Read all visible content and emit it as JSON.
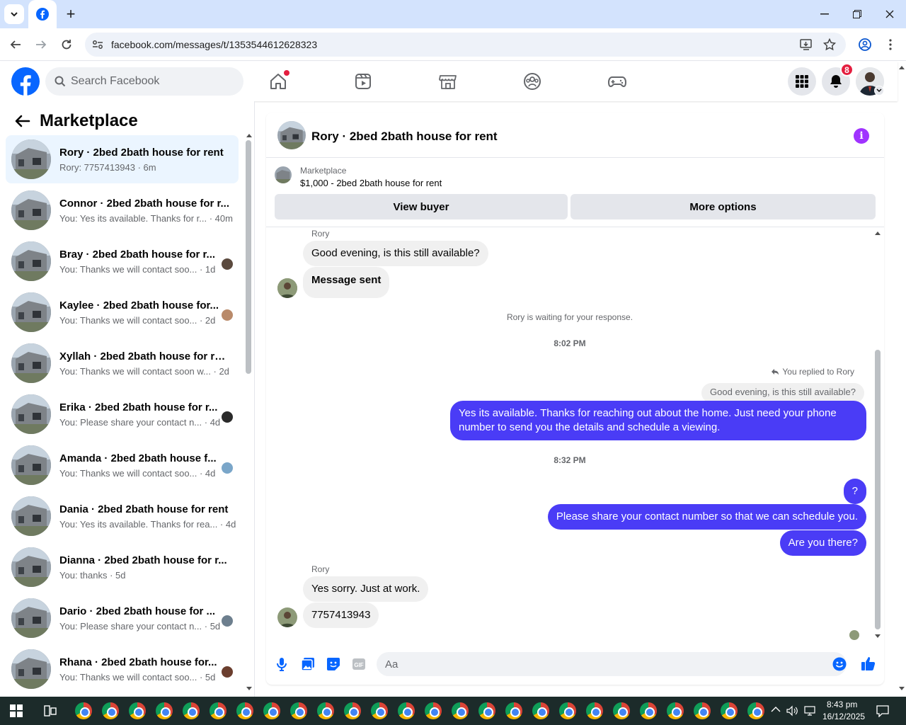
{
  "browser": {
    "url": "facebook.com/messages/t/1353544612628323"
  },
  "header": {
    "search_placeholder": "Search Facebook",
    "notification_count": "8"
  },
  "sidebar": {
    "title": "Marketplace",
    "conversations": [
      {
        "name": "Rory · 2bed 2bath house for rent",
        "preview": "Rory: 7757413943 · 6m",
        "selected": true
      },
      {
        "name": "Connor · 2bed 2bath house for r...",
        "preview": "You: Yes its available. Thanks for r... · 40m"
      },
      {
        "name": "Bray · 2bed 2bath house for r...",
        "preview": "You: Thanks we will contact soo... · 1d"
      },
      {
        "name": "Kaylee · 2bed 2bath house for...",
        "preview": "You: Thanks we will contact soo... · 2d"
      },
      {
        "name": "Xyllah · 2bed 2bath house for rent",
        "preview": "You: Thanks we will contact soon w... · 2d"
      },
      {
        "name": "Erika · 2bed 2bath house for r...",
        "preview": "You: Please share your contact n... · 4d"
      },
      {
        "name": "Amanda · 2bed 2bath house f...",
        "preview": "You: Thanks we will contact soo... · 4d"
      },
      {
        "name": "Dania · 2bed 2bath house for rent",
        "preview": "You: Yes its available. Thanks for rea... · 4d"
      },
      {
        "name": "Dianna · 2bed 2bath house for r...",
        "preview": "You: thanks · 5d"
      },
      {
        "name": "Dario · 2bed 2bath house for ...",
        "preview": "You: Please share your contact n... · 5d"
      },
      {
        "name": "Rhana · 2bed 2bath house for...",
        "preview": "You: Thanks we will contact soo... · 5d"
      }
    ]
  },
  "chat": {
    "title": "Rory · 2bed 2bath house for rent",
    "marketplace_label": "Marketplace",
    "listing": "$1,000 - 2bed 2bath house for rent",
    "view_buyer": "View buyer",
    "more_options": "More options",
    "sender1": "Rory",
    "msg1": "Good evening, is this still available?",
    "msg2": "Message sent",
    "waiting": "Rory is waiting for your response.",
    "time1": "8:02 PM",
    "replied_to": "You replied to Rory",
    "quoted": "Good evening, is this still available?",
    "out1": "Yes its available. Thanks for reaching out about the home. Just need your phone number to send you the details and schedule a viewing.",
    "time2": "8:32 PM",
    "out2": "?",
    "out3": "Please share your contact number so that we can schedule you.",
    "out4": "Are you there?",
    "sender2": "Rory",
    "msg3": "Yes sorry. Just at work.",
    "msg4": "7757413943",
    "composer_placeholder": "Aa"
  },
  "taskbar": {
    "time": "8:43 pm",
    "date": "16/12/2025"
  },
  "colors": {
    "accent": "#4a3cf6",
    "fb_blue": "#0866ff",
    "info": "#a033ff"
  }
}
